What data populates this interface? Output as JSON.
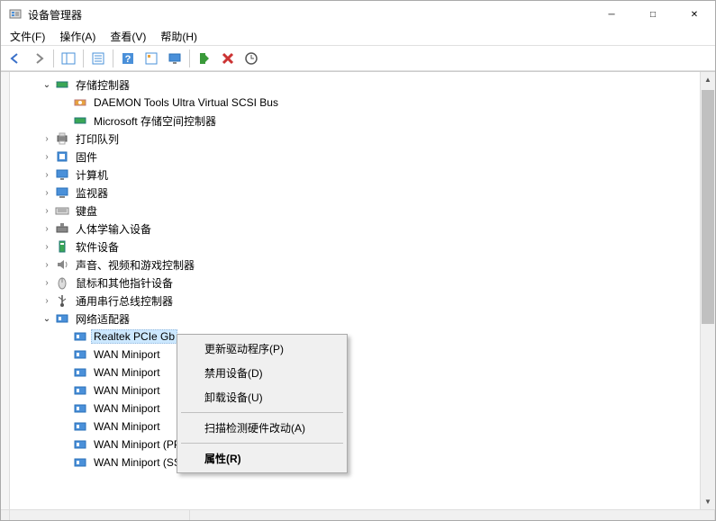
{
  "window": {
    "title": "设备管理器"
  },
  "menu": {
    "file": "文件(F)",
    "action": "操作(A)",
    "view": "查看(V)",
    "help": "帮助(H)"
  },
  "toolbar": {
    "back": "back-icon",
    "forward": "forward-icon",
    "up_pane": "tree-pane-icon",
    "properties": "properties-icon",
    "help": "help-icon",
    "toggle": "toggle-icon",
    "monitor": "display-icon",
    "enable": "enable-icon",
    "uninstall": "uninstall-icon",
    "scan": "scan-icon"
  },
  "tree": {
    "storage_controllers": {
      "label": "存储控制器",
      "expanded": true,
      "children": {
        "daemon": "DAEMON Tools Ultra Virtual SCSI Bus",
        "ms_storage": "Microsoft 存储空间控制器"
      }
    },
    "print_queue": {
      "label": "打印队列"
    },
    "firmware": {
      "label": "固件"
    },
    "computer": {
      "label": "计算机"
    },
    "monitor": {
      "label": "监视器"
    },
    "keyboard": {
      "label": "键盘"
    },
    "hid": {
      "label": "人体学输入设备"
    },
    "software_devices": {
      "label": "软件设备"
    },
    "audio": {
      "label": "声音、视频和游戏控制器"
    },
    "mouse": {
      "label": "鼠标和其他指针设备"
    },
    "usb": {
      "label": "通用串行总线控制器"
    },
    "network": {
      "label": "网络适配器",
      "expanded": true,
      "children": {
        "selected": "Realtek PCIe Gb",
        "wan1": "WAN Miniport",
        "wan2": "WAN Miniport",
        "wan3": "WAN Miniport",
        "wan4": "WAN Miniport",
        "wan5": "WAN Miniport",
        "wan6": "WAN Miniport (PPTP)",
        "wan7": "WAN Miniport (SSTP)"
      }
    }
  },
  "context_menu": {
    "update_driver": "更新驱动程序(P)",
    "disable": "禁用设备(D)",
    "uninstall": "卸载设备(U)",
    "scan_hw": "扫描检测硬件改动(A)",
    "properties": "属性(R)"
  }
}
